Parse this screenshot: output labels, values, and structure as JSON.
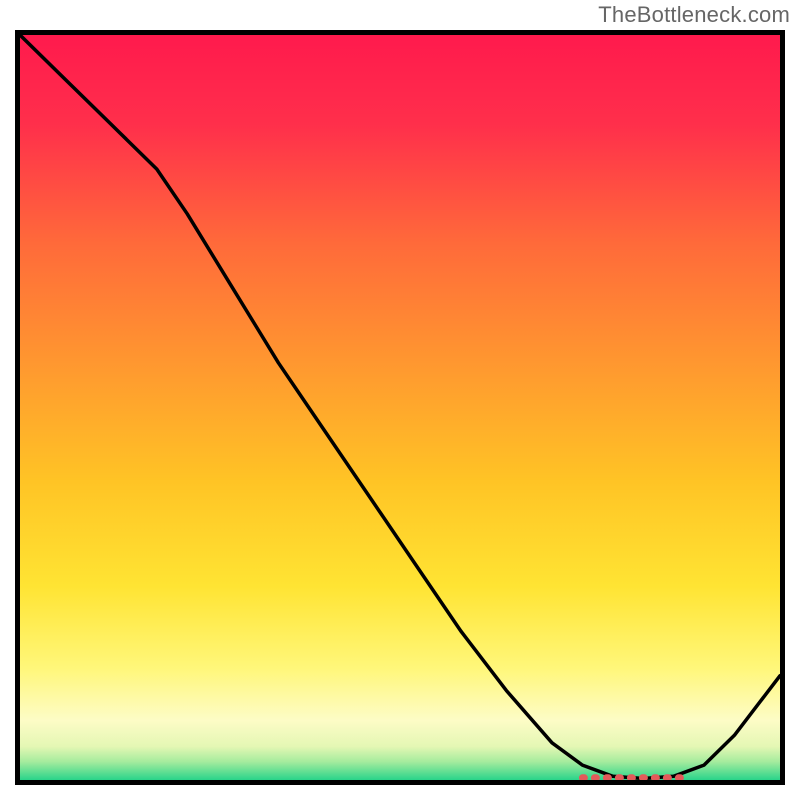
{
  "watermark": "TheBottleneck.com",
  "chart_data": {
    "type": "line",
    "title": "",
    "xlabel": "",
    "ylabel": "",
    "xlim": [
      0,
      100
    ],
    "ylim": [
      0,
      100
    ],
    "grid": false,
    "legend": false,
    "curve": {
      "x": [
        0,
        6,
        12,
        18,
        22,
        28,
        34,
        40,
        46,
        52,
        58,
        64,
        70,
        74,
        78,
        82,
        86,
        90,
        94,
        100
      ],
      "y": [
        100,
        94,
        88,
        82,
        76,
        66,
        56,
        47,
        38,
        29,
        20,
        12,
        5,
        2,
        0.5,
        0.2,
        0.5,
        2,
        6,
        14
      ]
    },
    "optimal_zone": {
      "x_start": 74,
      "x_end": 88,
      "y": 0.3
    },
    "gradient_stops": [
      {
        "offset": 0.0,
        "color": "#ff1a4d"
      },
      {
        "offset": 0.12,
        "color": "#ff2f4b"
      },
      {
        "offset": 0.28,
        "color": "#ff6a3a"
      },
      {
        "offset": 0.45,
        "color": "#ff9a2f"
      },
      {
        "offset": 0.6,
        "color": "#ffc425"
      },
      {
        "offset": 0.74,
        "color": "#ffe433"
      },
      {
        "offset": 0.85,
        "color": "#fff77a"
      },
      {
        "offset": 0.92,
        "color": "#fdfcc6"
      },
      {
        "offset": 0.955,
        "color": "#e4f7b4"
      },
      {
        "offset": 0.975,
        "color": "#a7ec9e"
      },
      {
        "offset": 1.0,
        "color": "#29d48a"
      }
    ]
  }
}
